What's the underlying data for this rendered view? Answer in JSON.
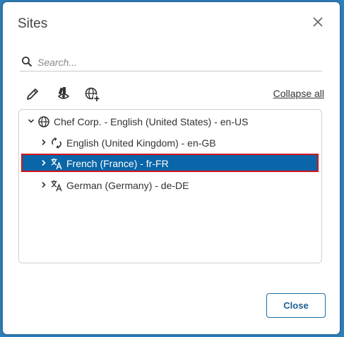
{
  "dialog": {
    "title": "Sites",
    "close_icon": "close-icon"
  },
  "search": {
    "placeholder": "Search...",
    "value": "",
    "icon": "search-icon"
  },
  "toolbar": {
    "edit_icon": "pencil-icon",
    "preview_icon": "preview-icon",
    "add_site_icon": "globe-plus-icon",
    "collapse_label": "Collapse all"
  },
  "tree": {
    "items": [
      {
        "label": "Chef Corp. - English (United States) - en-US",
        "icon": "globe-icon",
        "expanded": true,
        "selected": false
      },
      {
        "label": "English (United Kingdom) - en-GB",
        "icon": "sync-icon",
        "expanded": false,
        "selected": false
      },
      {
        "label": "French (France) - fr-FR",
        "icon": "translate-icon",
        "expanded": false,
        "selected": true
      },
      {
        "label": "German (Germany) - de-DE",
        "icon": "translate-icon",
        "expanded": false,
        "selected": false
      }
    ]
  },
  "footer": {
    "close_label": "Close"
  },
  "colors": {
    "accent": "#0a66a8",
    "selection_border": "#d4141c",
    "backdrop": "#2f7fb8"
  }
}
